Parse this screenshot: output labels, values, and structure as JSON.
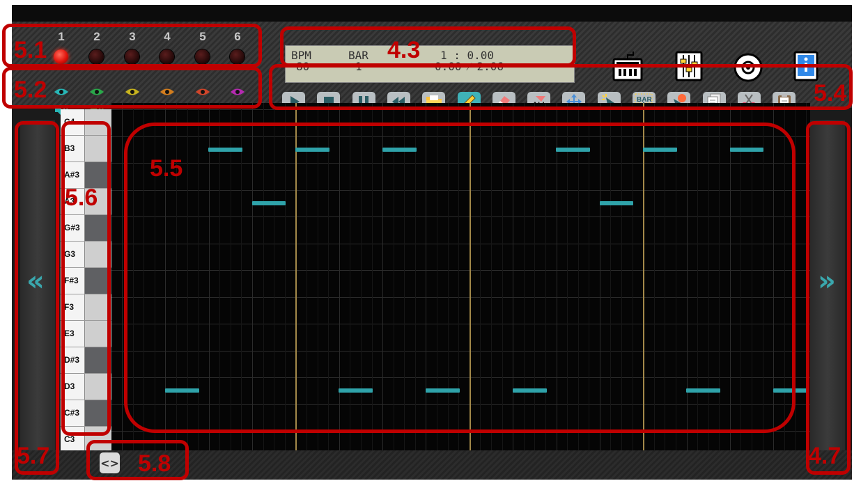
{
  "tracks": {
    "numbers": [
      "1",
      "2",
      "3",
      "4",
      "5",
      "6"
    ],
    "active_index": 0,
    "colors": [
      "#27b6b6",
      "#2aa84a",
      "#c8b41e",
      "#d27d1e",
      "#d0452a",
      "#b52ab0"
    ]
  },
  "lcd": {
    "bpm_label": "BPM",
    "bpm_value": "80",
    "bar_label": "BAR",
    "bar_value": "1",
    "position": "1 : 0.00",
    "time": "0:00 ⁄ 2:06"
  },
  "header_icons": [
    "keyboard-icon",
    "mixer-icon",
    "disc-icon",
    "info-book-icon"
  ],
  "toolbar": {
    "tools": [
      "play-icon",
      "stop-icon",
      "pause-icon",
      "rewind-icon",
      "folder-icon",
      "pencil-icon",
      "eraser-icon",
      "select-all-icon",
      "move-icon",
      "select-icon",
      "select-bar-icon",
      "add-point-icon",
      "copy-icon",
      "cut-icon",
      "paste-icon"
    ],
    "all_label": "ALL",
    "bar_label": "BAR",
    "active_tool": "pencil-icon"
  },
  "piano_keys": [
    "C4",
    "B3",
    "A#3",
    "A3",
    "G#3",
    "G3",
    "F#3",
    "F3",
    "E3",
    "D#3",
    "D3",
    "C#3",
    "C3"
  ],
  "navigation": {
    "left_arrow": "«",
    "right_arrow": "»",
    "scroll_icon": "<>"
  },
  "annotations": [
    "5.1",
    "5.2",
    "4.3",
    "5.4",
    "5.5",
    "5.6",
    "5.7",
    "5.8",
    "4.7"
  ],
  "notes": [
    {
      "pitch": "B3",
      "start": 1.0,
      "length": 0.75
    },
    {
      "pitch": "B3",
      "start": 3.0,
      "length": 0.75
    },
    {
      "pitch": "B3",
      "start": 5.0,
      "length": 0.75
    },
    {
      "pitch": "B3",
      "start": 9.0,
      "length": 0.75
    },
    {
      "pitch": "B3",
      "start": 11.0,
      "length": 0.75
    },
    {
      "pitch": "B3",
      "start": 13.0,
      "length": 0.75
    },
    {
      "pitch": "A3",
      "start": 2.0,
      "length": 0.75
    },
    {
      "pitch": "A3",
      "start": 10.0,
      "length": 0.75
    },
    {
      "pitch": "D3",
      "start": 0.0,
      "length": 0.75
    },
    {
      "pitch": "D3",
      "start": 4.0,
      "length": 0.75
    },
    {
      "pitch": "D3",
      "start": 6.0,
      "length": 0.75
    },
    {
      "pitch": "D3",
      "start": 8.0,
      "length": 0.75
    },
    {
      "pitch": "D3",
      "start": 12.0,
      "length": 0.75
    },
    {
      "pitch": "D3",
      "start": 14.0,
      "length": 0.75
    }
  ]
}
